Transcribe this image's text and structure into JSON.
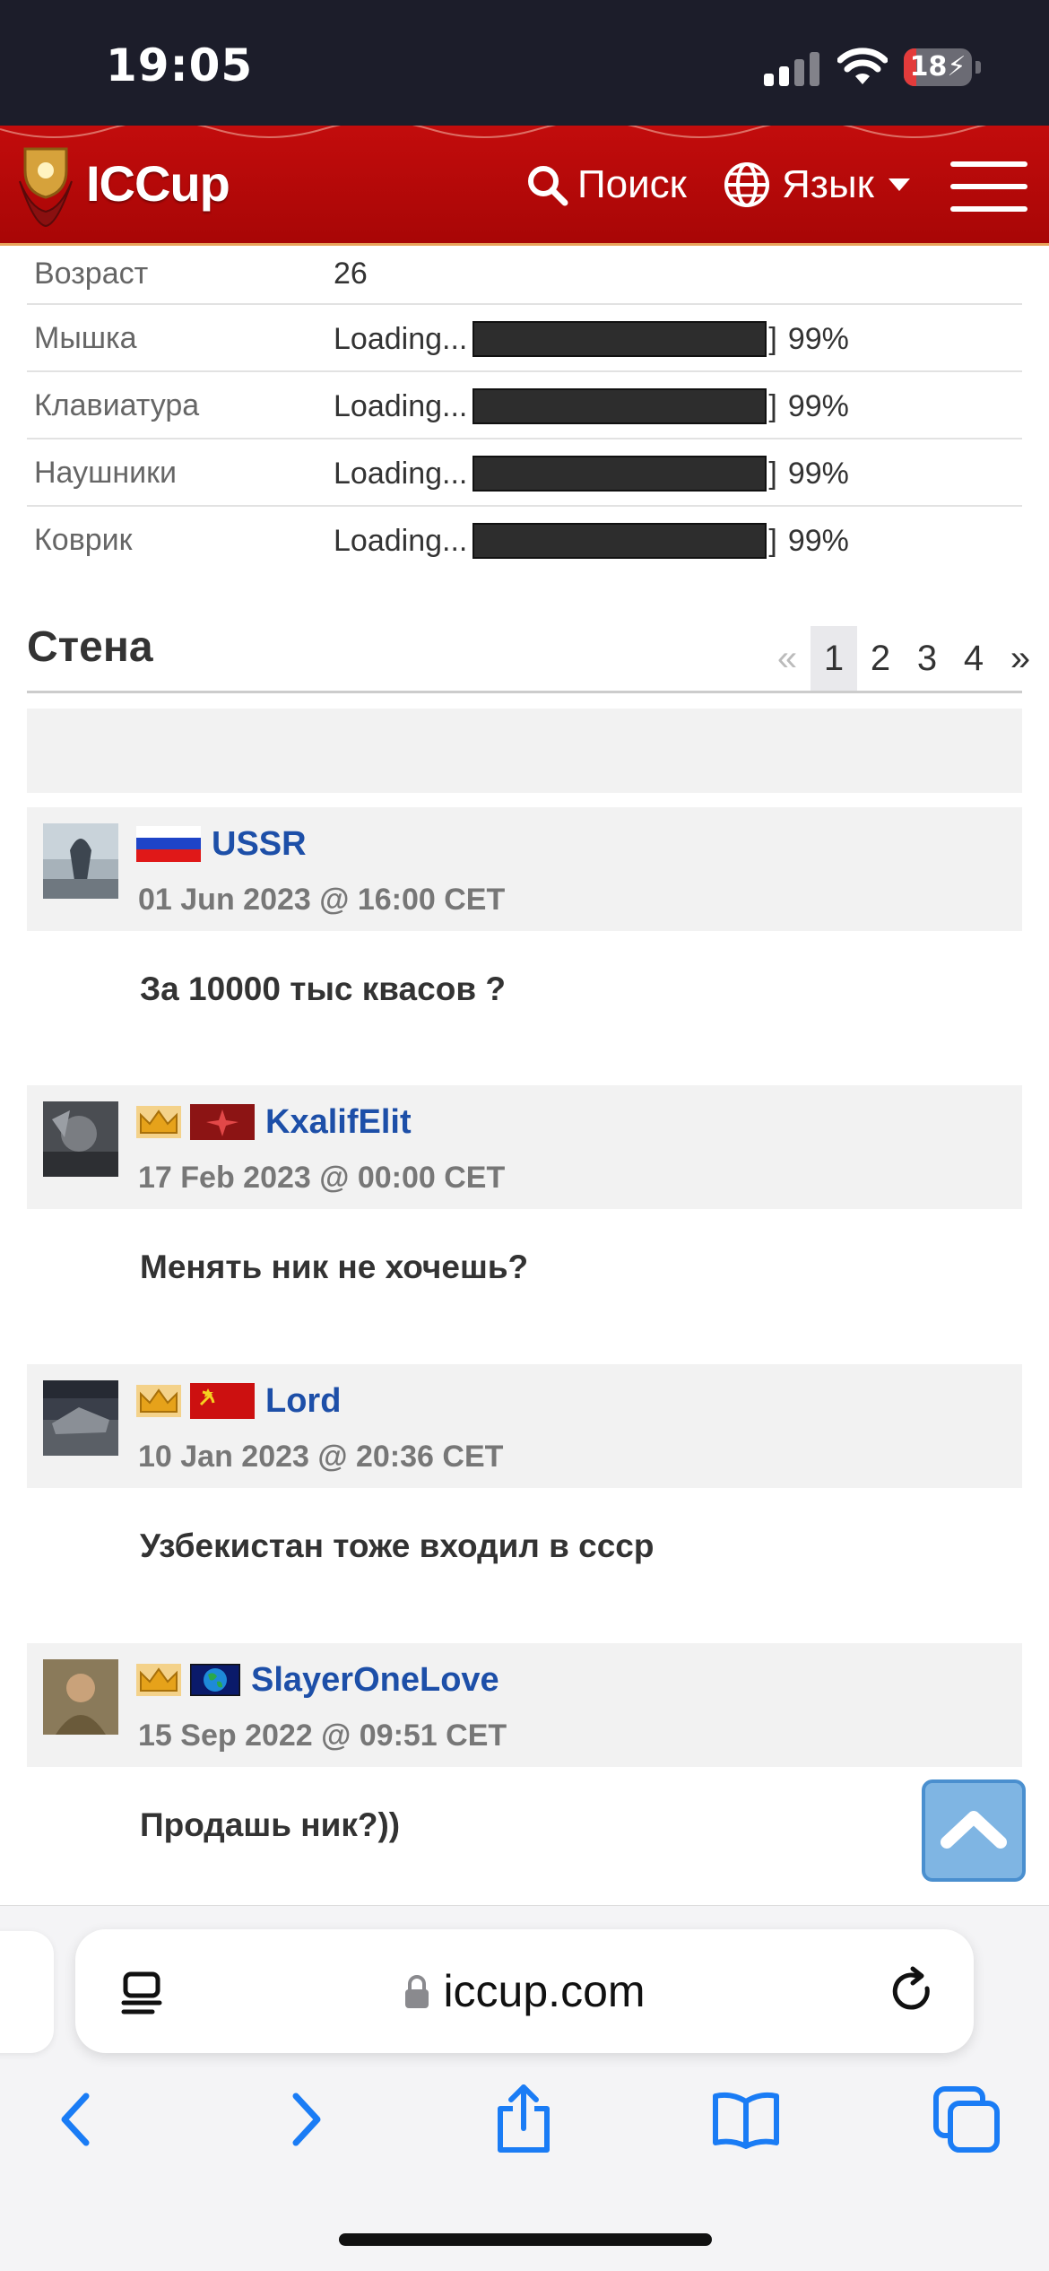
{
  "status_bar": {
    "time": "19:05",
    "battery": "18",
    "battery_level": 0.18
  },
  "header": {
    "logo": "ICCup",
    "search_label": "Поиск",
    "language_label": "Язык"
  },
  "profile": {
    "rows": [
      {
        "label": "Возраст",
        "value": "26"
      },
      {
        "label": "Мышка",
        "value": "Loading...",
        "bracket": "]",
        "percent": "99%"
      },
      {
        "label": "Клавиатура",
        "value": "Loading...",
        "bracket": "]",
        "percent": "99%"
      },
      {
        "label": "Наушники",
        "value": "Loading...",
        "bracket": "]",
        "percent": "99%"
      },
      {
        "label": "Коврик",
        "value": "Loading...",
        "bracket": "]",
        "percent": "99%"
      }
    ]
  },
  "wall": {
    "title": "Стена",
    "pagination": {
      "prev": "«",
      "pages": [
        "1",
        "2",
        "3",
        "4"
      ],
      "next": "»",
      "current": "1"
    },
    "posts": [
      {
        "user": "USSR",
        "date": "01 Jun 2023 @ 16:00 CET",
        "text": "За 10000 тыс квасов ?",
        "flag": "russia-flag-icon"
      },
      {
        "user": "KxalifElit",
        "date": "17 Feb 2023 @ 00:00 CET",
        "text": "Менять ник не хочешь?",
        "flag": "clan-flag-icon"
      },
      {
        "user": "Lord",
        "date": "10 Jan 2023 @ 20:36 CET",
        "text": "Узбекистан тоже входил в ссср",
        "flag": "ussr-flag-icon"
      },
      {
        "user": "SlayerOneLove",
        "date": "15 Sep 2022 @ 09:51 CET",
        "text": "Продашь ник?))",
        "flag": "world-flag-icon"
      }
    ]
  },
  "browser": {
    "url": "iccup.com"
  },
  "colors": {
    "header_red": "#b80909",
    "link_blue": "#1d4fa8",
    "scroll_button": "#7fb5e3"
  }
}
